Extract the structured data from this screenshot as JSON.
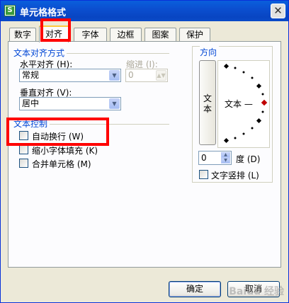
{
  "window": {
    "title": "单元格格式",
    "app_icon_glyph": "S",
    "close_glyph": "✕"
  },
  "tabs": [
    {
      "label": "数字",
      "active": false
    },
    {
      "label": "对齐",
      "active": true
    },
    {
      "label": "字体",
      "active": false
    },
    {
      "label": "边框",
      "active": false
    },
    {
      "label": "图案",
      "active": false
    },
    {
      "label": "保护",
      "active": false
    }
  ],
  "text_alignment": {
    "group_title": "文本对齐方式",
    "horizontal_label": "水平对齐 (H):",
    "horizontal_value": "常规",
    "indent_label": "缩进 (I):",
    "indent_value": "0",
    "vertical_label": "垂直对齐 (V):",
    "vertical_value": "居中"
  },
  "text_control": {
    "group_title": "文本控制",
    "wrap_text_label": "自动换行 (W)",
    "wrap_text_checked": false,
    "shrink_to_fit_label": "缩小字体填充 (K)",
    "shrink_to_fit_checked": false,
    "merge_cells_label": "合并单元格 (M)",
    "merge_cells_checked": false
  },
  "orientation": {
    "group_title": "方向",
    "vertical_text_label": "文本",
    "dial_text": "文本 —",
    "degrees_value": "0",
    "degrees_label": "度 (D)",
    "vertical_stack_label": "文字竖排 (L)",
    "vertical_stack_checked": false
  },
  "buttons": {
    "ok_label": "确定",
    "cancel_label": "取消"
  },
  "colors": {
    "titlebar": "#0a4bc8",
    "group_title": "#0046d5",
    "highlight_box": "#ff0000",
    "dial_dot": "#000000",
    "dial_active_dot": "#c00000"
  },
  "watermark_text": "Baidu 经验"
}
